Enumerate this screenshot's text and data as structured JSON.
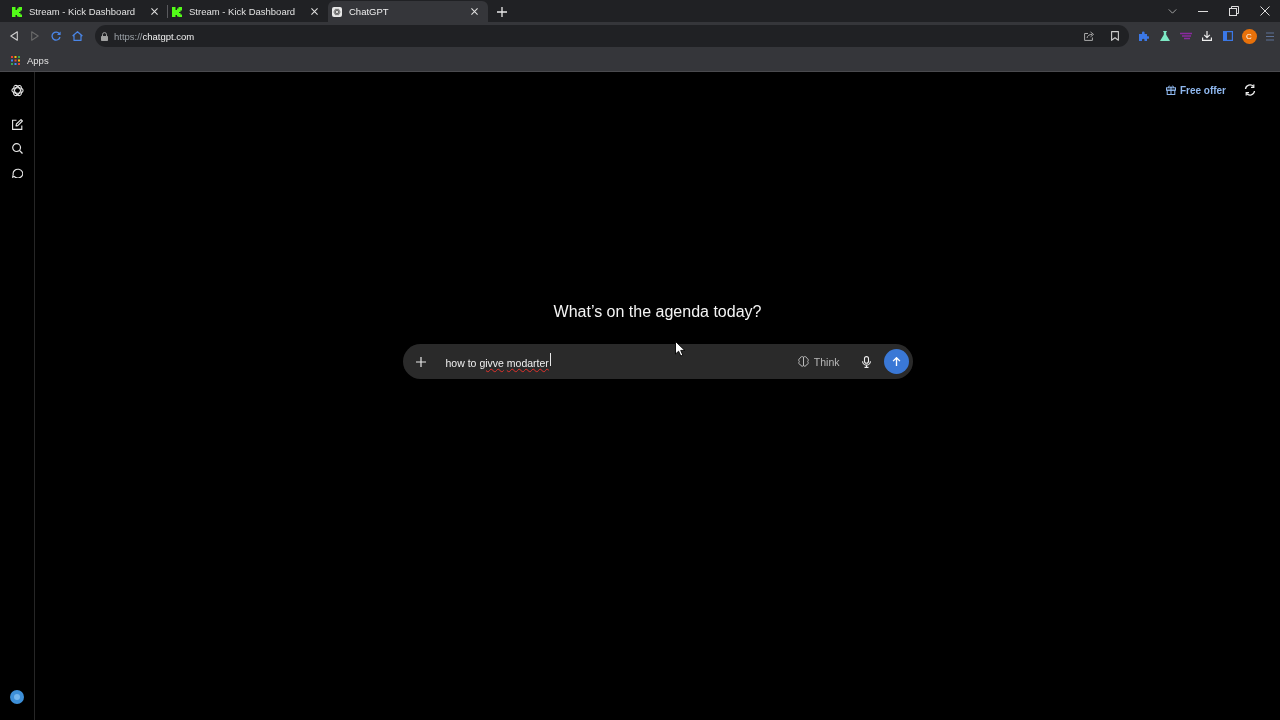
{
  "browser": {
    "tabs": [
      {
        "title": "Stream - Kick Dashboard",
        "kind": "kick",
        "selected": false
      },
      {
        "title": "Stream - Kick Dashboard",
        "kind": "kick",
        "selected": false
      },
      {
        "title": "ChatGPT",
        "kind": "chatgpt",
        "selected": true
      }
    ],
    "address": {
      "scheme": "https://",
      "host": "chatgpt.com"
    },
    "profile_initial": "C",
    "bookmarks": [
      {
        "label": "Apps"
      }
    ]
  },
  "header": {
    "offer_label": "Free offer"
  },
  "main": {
    "heading": "What’s on the agenda today?",
    "composer": {
      "words": [
        {
          "text": "how",
          "misspelled": false
        },
        {
          "text": "to",
          "misspelled": false
        },
        {
          "text": "givve",
          "misspelled": true
        },
        {
          "text": "modarter",
          "misspelled": true
        }
      ],
      "think_label": "Think"
    }
  }
}
